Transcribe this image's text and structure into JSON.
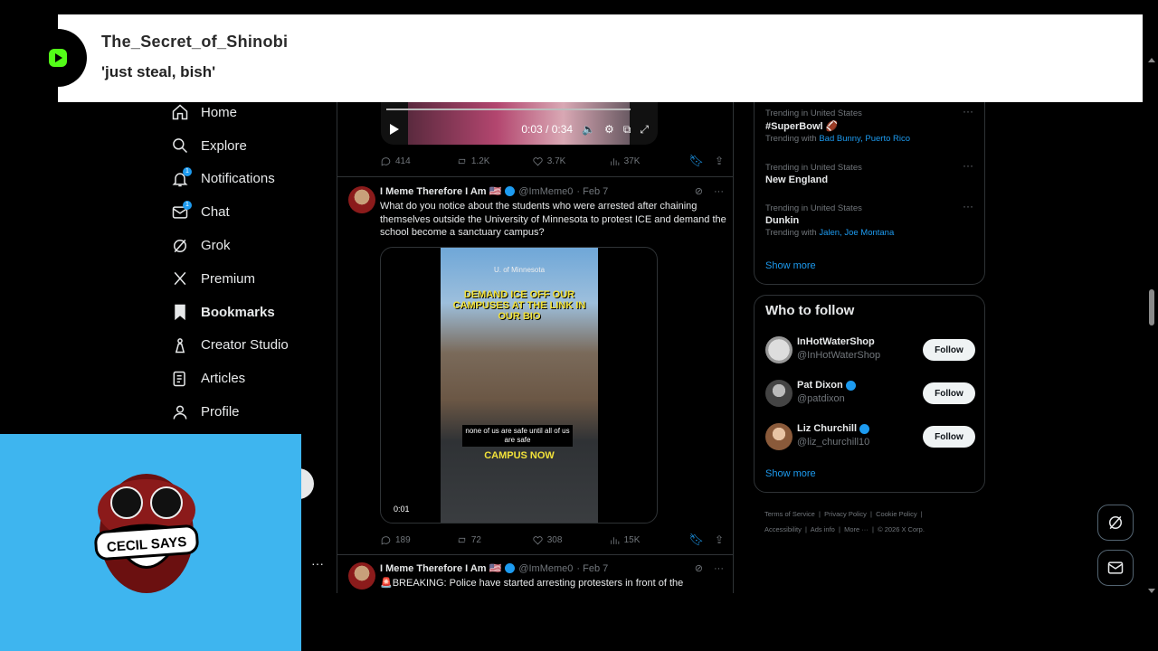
{
  "alert": {
    "username": "The_Secret_of_Shinobi",
    "message": "'just steal, bish'"
  },
  "nav": {
    "items": [
      {
        "label": "Home",
        "icon": "home-icon"
      },
      {
        "label": "Explore",
        "icon": "search-icon"
      },
      {
        "label": "Notifications",
        "icon": "bell-icon",
        "badge": "1"
      },
      {
        "label": "Chat",
        "icon": "mail-icon",
        "badge": "1"
      },
      {
        "label": "Grok",
        "icon": "grok-icon"
      },
      {
        "label": "Premium",
        "icon": "x-icon"
      },
      {
        "label": "Bookmarks",
        "icon": "bookmark-icon"
      },
      {
        "label": "Creator Studio",
        "icon": "creator-icon"
      },
      {
        "label": "Articles",
        "icon": "articles-icon"
      },
      {
        "label": "Profile",
        "icon": "profile-icon"
      }
    ]
  },
  "post0": {
    "video_time": "0:03 / 0:34",
    "replies": "414",
    "reposts": "1.2K",
    "likes": "3.7K",
    "views": "37K"
  },
  "post1": {
    "author": "I Meme Therefore I Am 🇺🇸",
    "handle": "@ImMeme0",
    "date": "· Feb 7",
    "text": "What do you notice about the students who were arrested after chaining themselves outside the University of Minnesota to protest ICE and demand the school become a sanctuary campus?",
    "video_caption_top": "U. of Minnesota",
    "video_caption": "DEMAND ICE OFF OUR CAMPUSES AT THE LINK IN OUR BIO",
    "video_subtitle": "none of us are safe until all of us are safe",
    "video_caption_bottom": "CAMPUS NOW",
    "video_time": "0:01",
    "replies": "189",
    "reposts": "72",
    "likes": "308",
    "views": "15K"
  },
  "post2": {
    "author": "I Meme Therefore I Am 🇺🇸",
    "handle": "@ImMeme0",
    "date": "· Feb 7",
    "text": "🚨BREAKING: Police have started arresting protesters in front of the"
  },
  "trends": [
    {
      "context": "Trending in United States",
      "title": "#SuperBowl 🏈",
      "with_prefix": "Trending with",
      "with": "Bad Bunny, Puerto Rico"
    },
    {
      "context": "Trending in United States",
      "title": "New England",
      "with_prefix": "",
      "with": ""
    },
    {
      "context": "Trending in United States",
      "title": "Dunkin",
      "with_prefix": "Trending with",
      "with": "Jalen, Joe Montana"
    }
  ],
  "trends_show_more": "Show more",
  "who_to_follow": {
    "title": "Who to follow",
    "accounts": [
      {
        "name": "InHotWaterShop",
        "handle": "@InHotWaterShop",
        "verified": false,
        "button": "Follow"
      },
      {
        "name": "Pat Dixon",
        "handle": "@patdixon",
        "verified": true,
        "button": "Follow"
      },
      {
        "name": "Liz Churchill",
        "handle": "@liz_churchill10",
        "verified": true,
        "button": "Follow"
      }
    ],
    "show_more": "Show more"
  },
  "footer": {
    "links": [
      "Terms of Service",
      "Privacy Policy",
      "Cookie Policy",
      "Accessibility",
      "Ads info",
      "More ···"
    ],
    "copyright": "© 2026 X Corp."
  },
  "webcam": {
    "logo_text": "CECIL SAYS"
  },
  "colors": {
    "accent": "#1d9bf0",
    "webcam_bg": "#3eb5ef",
    "alert_bg": "#ffffff",
    "logo_green": "#53fc18"
  }
}
